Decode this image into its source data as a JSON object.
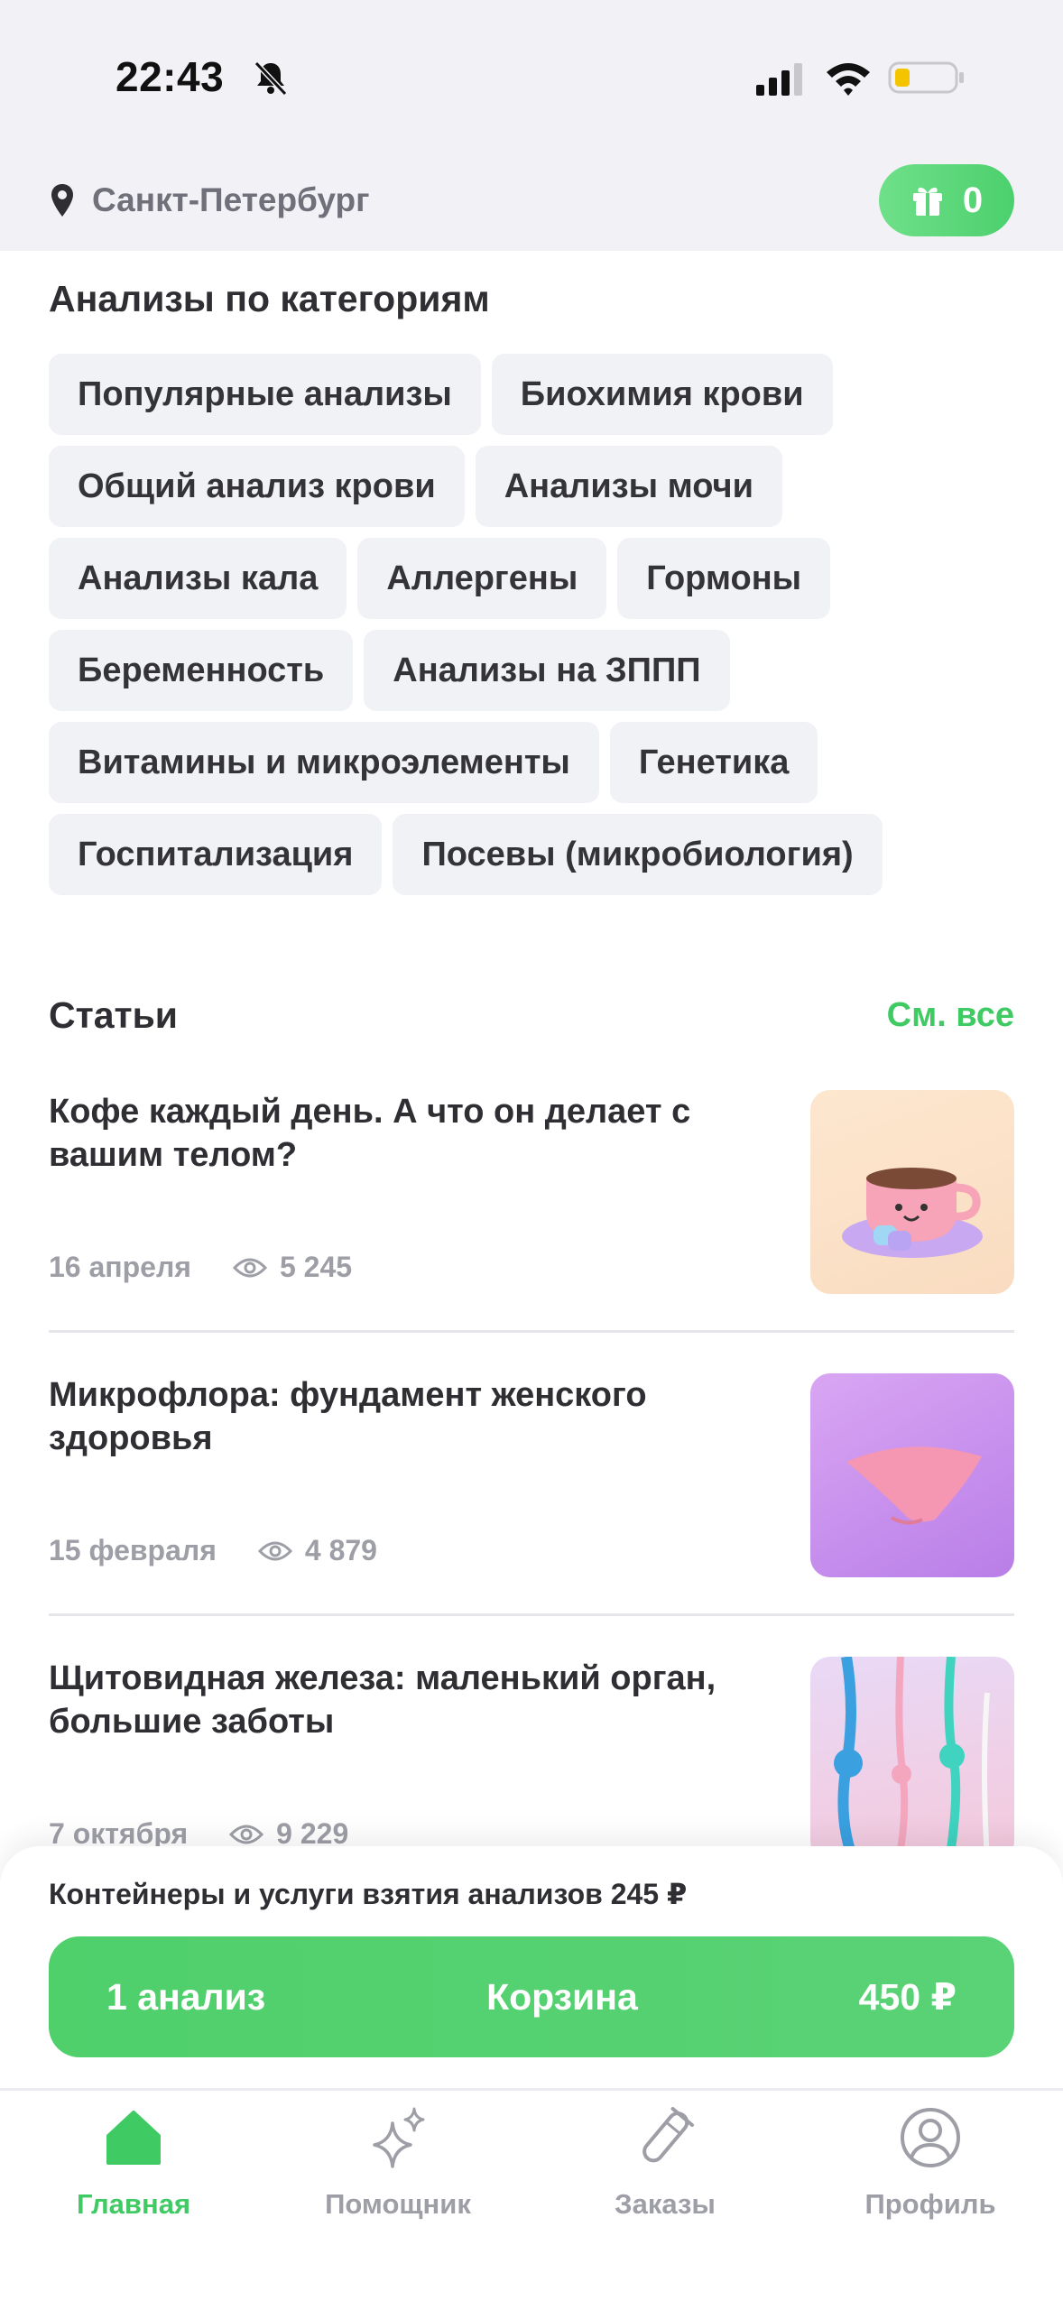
{
  "status_bar": {
    "time": "22:43"
  },
  "header": {
    "city": "Санкт-Петербург",
    "bonus_count": "0"
  },
  "categories": {
    "title": "Анализы по категориям",
    "rows": [
      [
        "Популярные анализы",
        "Биохимия крови"
      ],
      [
        "Общий анализ крови",
        "Анализы мочи"
      ],
      [
        "Анализы кала",
        "Аллергены",
        "Гормоны"
      ],
      [
        "Беременность",
        "Анализы на ЗППП"
      ],
      [
        "Витамины и микроэлементы",
        "Генетика"
      ],
      [
        "Госпитализация",
        "Посевы (микробиология)"
      ]
    ]
  },
  "articles": {
    "title": "Статьи",
    "see_all": "См. все",
    "items": [
      {
        "title": "Кофе каждый день. А что он делает с вашим телом?",
        "date": "16 апреля",
        "views": "5 245"
      },
      {
        "title": "Микрофлора: фундамент женского здоровья",
        "date": "15 февраля",
        "views": "4 879"
      },
      {
        "title": "Щитовидная железа: маленький орган, большие заботы",
        "date": "7 октября",
        "views": "9 229"
      }
    ]
  },
  "cart": {
    "note": "Контейнеры и услуги взятия анализов 245 ₽",
    "count_label": "1 анализ",
    "button_label": "Корзина",
    "total": "450 ₽"
  },
  "tabbar": {
    "items": [
      {
        "label": "Главная",
        "icon": "home-icon",
        "active": true
      },
      {
        "label": "Помощник",
        "icon": "sparkle-icon",
        "active": false
      },
      {
        "label": "Заказы",
        "icon": "test-tube-icon",
        "active": false
      },
      {
        "label": "Профиль",
        "icon": "profile-icon",
        "active": false
      }
    ]
  },
  "colors": {
    "accent": "#4cd06d",
    "chip_bg": "#f1f2f5",
    "muted": "#9d9ea6"
  }
}
